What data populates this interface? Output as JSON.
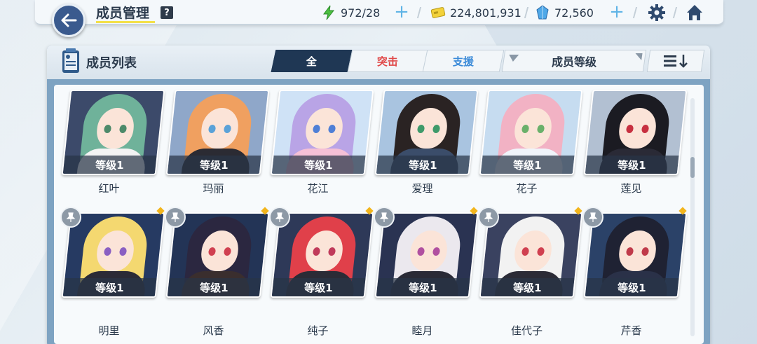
{
  "header": {
    "title": "成员管理",
    "help_label": "?",
    "stamina": "972/28",
    "credits": "224,801,931",
    "gems": "72,560",
    "plus_label": "+"
  },
  "panel": {
    "title": "成员列表",
    "tabs": [
      {
        "label": "全",
        "state": "active"
      },
      {
        "label": "突击",
        "color": "#e04848"
      },
      {
        "label": "支援",
        "color": "#3a8ad8"
      }
    ],
    "sort_label": "成员等级"
  },
  "members": [
    {
      "name": "红叶",
      "level": "等级1",
      "hair": "#6fb29a",
      "eye": "#4d8a6a",
      "body": "#f3f3f3",
      "bg": "#3c4a6a"
    },
    {
      "name": "玛丽",
      "level": "等级1",
      "hair": "#f0a060",
      "eye": "#5aa2d8",
      "body": "#2b2b33",
      "bg": "#8fa7c9"
    },
    {
      "name": "花江",
      "level": "等级1",
      "hair": "#b9a4e6",
      "eye": "#4f7fd6",
      "body": "#f5c0d6",
      "bg": "#cfe2f6"
    },
    {
      "name": "爱理",
      "level": "等级1",
      "hair": "#2a2323",
      "eye": "#3f9a6a",
      "body": "#3b4d6a",
      "bg": "#a9c4e0"
    },
    {
      "name": "花子",
      "level": "等级1",
      "hair": "#f2b2c4",
      "eye": "#6ab06a",
      "body": "#f0f4fa",
      "bg": "#c6dcf0"
    },
    {
      "name": "莲见",
      "level": "等级1",
      "hair": "#1b1b22",
      "eye": "#c73040",
      "body": "#2a2a36",
      "bg": "#b2c0d2"
    },
    {
      "name": "明里",
      "level": "等级1",
      "hair": "#f4d870",
      "eye": "#8a5fc2",
      "body": "#2b2b36",
      "bg": "#263a62"
    },
    {
      "name": "风香",
      "level": "等级1",
      "hair": "#2b2740",
      "eye": "#d04050",
      "body": "#3a2e2e",
      "bg": "#233456"
    },
    {
      "name": "纯子",
      "level": "等级1",
      "hair": "#e0404a",
      "eye": "#c03a5a",
      "body": "#2b2b36",
      "bg": "#2e3958"
    },
    {
      "name": "睦月",
      "level": "等级1",
      "hair": "#ebe8ee",
      "eye": "#b050a0",
      "body": "#2a2a36",
      "bg": "#2a3352"
    },
    {
      "name": "佳代子",
      "level": "等级1",
      "hair": "#f2f2f2",
      "eye": "#d04050",
      "body": "#2b2b36",
      "bg": "#3a4260"
    },
    {
      "name": "芹香",
      "level": "等级1",
      "hair": "#1f2233",
      "eye": "#c03a4a",
      "body": "#2a3148",
      "bg": "#2b4268"
    }
  ]
}
